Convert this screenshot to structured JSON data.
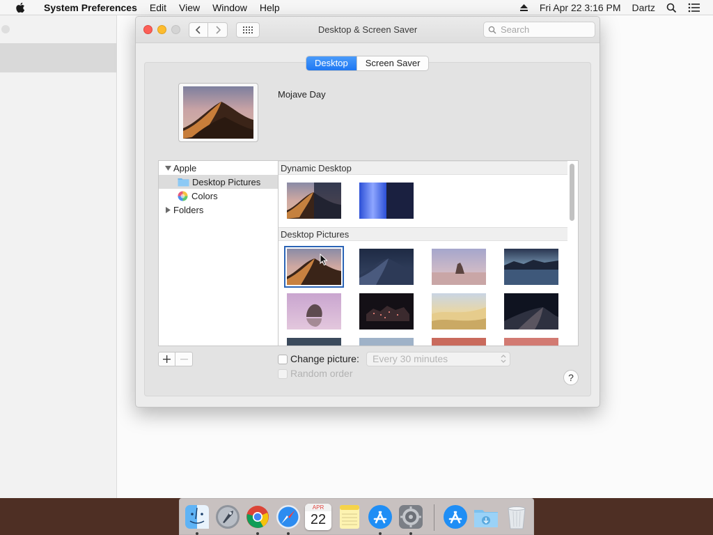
{
  "menubar": {
    "app_name": "System Preferences",
    "menus": [
      "Edit",
      "View",
      "Window",
      "Help"
    ],
    "datetime": "Fri Apr 22  3:16 PM",
    "user": "Dartz"
  },
  "window": {
    "title": "Desktop & Screen Saver",
    "search_placeholder": "Search",
    "tabs": [
      {
        "label": "Desktop",
        "active": true
      },
      {
        "label": "Screen Saver",
        "active": false
      }
    ],
    "current_wallpaper": "Mojave Day",
    "source_list": [
      {
        "label": "Apple",
        "type": "group",
        "expanded": true
      },
      {
        "label": "Desktop Pictures",
        "type": "folder",
        "selected": true
      },
      {
        "label": "Colors",
        "type": "colors"
      },
      {
        "label": "Folders",
        "type": "group",
        "expanded": false
      }
    ],
    "sections": [
      {
        "title": "Dynamic Desktop",
        "count": 2
      },
      {
        "title": "Desktop Pictures",
        "count": 12
      }
    ],
    "change_picture_label": "Change picture:",
    "change_picture_checked": false,
    "interval": "Every 30 minutes",
    "random_order_label": "Random order",
    "random_order_checked": false,
    "help": "?"
  },
  "dock": {
    "apps": [
      "Finder",
      "Launchpad",
      "Google Chrome",
      "Safari",
      "Calendar",
      "Notes",
      "App Store",
      "System Preferences",
      "App Store Downloads",
      "Downloads Folder",
      "Trash"
    ],
    "calendar_month": "APR",
    "calendar_day": "22"
  },
  "colors": {
    "accent": "#1f78f3",
    "selection_outline": "#2a63b5",
    "close": "#fc5f57",
    "minimize": "#fdbc2e"
  }
}
